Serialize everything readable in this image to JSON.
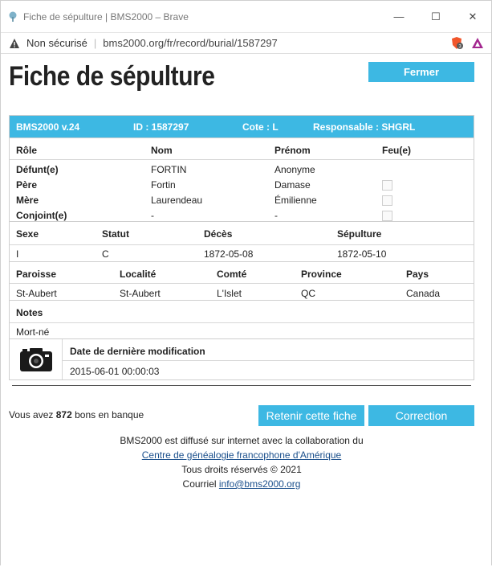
{
  "window": {
    "title": "Fiche de sépulture | BMS2000 – Brave",
    "minimize": "—",
    "maximize": "☐",
    "close": "✕"
  },
  "address": {
    "security": "Non sécurisé",
    "separator": "|",
    "url": "bms2000.org/fr/record/burial/1587297",
    "shield_count": "3"
  },
  "page": {
    "title": "Fiche de sépulture",
    "close_label": "Fermer"
  },
  "record_header": {
    "version": "BMS2000 v.24",
    "id": "ID : 1587297",
    "cote": "Cote : L",
    "responsable": "Responsable : SHGRL"
  },
  "persons": {
    "headers": [
      "Rôle",
      "Nom",
      "Prénom",
      "Feu(e)"
    ],
    "rows": [
      {
        "role": "Défunt(e)",
        "nom": "FORTIN",
        "prenom": "Anonyme",
        "feu": null
      },
      {
        "role": "Père",
        "nom": "Fortin",
        "prenom": "Damase",
        "feu": false
      },
      {
        "role": "Mère",
        "nom": "Laurendeau",
        "prenom": "Émilienne",
        "feu": false
      },
      {
        "role": "Conjoint(e)",
        "nom": "-",
        "prenom": "-",
        "feu": false
      }
    ]
  },
  "event": {
    "headers": [
      "Sexe",
      "Statut",
      "Décès",
      "Sépulture"
    ],
    "values": [
      "I",
      "C",
      "1872-05-08",
      "1872-05-10"
    ]
  },
  "place": {
    "headers": [
      "Paroisse",
      "Localité",
      "Comté",
      "Province",
      "Pays"
    ],
    "values": [
      "St-Aubert",
      "St-Aubert",
      "L'Islet",
      "QC",
      "Canada"
    ]
  },
  "notes": {
    "header": "Notes",
    "value": "Mort-né"
  },
  "modification": {
    "header": "Date de dernière modification",
    "value": "2015-06-01 00:00:03"
  },
  "bank": {
    "prefix": "Vous avez",
    "count": "872",
    "suffix": "bons en banque"
  },
  "actions": {
    "retain": "Retenir cette fiche",
    "correction": "Correction"
  },
  "footer": {
    "line1": "BMS2000 est diffusé sur internet avec la collaboration du",
    "link": "Centre de généalogie francophone d'Amérique",
    "rights": "Tous droits réservés © 2021",
    "email_label": "Courriel",
    "email": "info@bms2000.org"
  },
  "colors": {
    "accent": "#3db8e3"
  }
}
